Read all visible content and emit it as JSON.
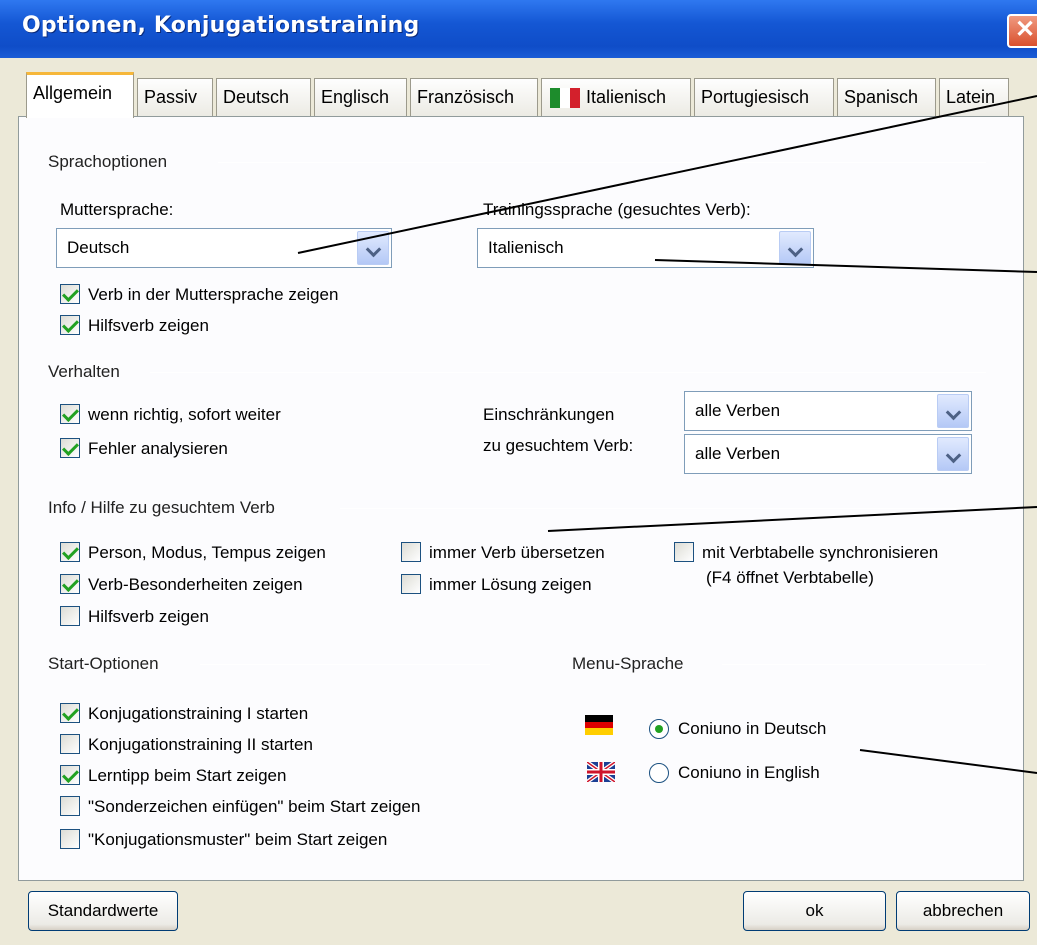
{
  "window": {
    "title": "Optionen, Konjugationstraining",
    "close_icon": "close-icon"
  },
  "tabs": [
    "Allgemein",
    "Passiv",
    "Deutsch",
    "Englisch",
    "Französisch",
    "Italienisch",
    "Portugiesisch",
    "Spanisch",
    "Latein"
  ],
  "sprachoptionen": {
    "title": "Sprachoptionen",
    "mutter_label": "Muttersprache:",
    "mutter_value": "Deutsch",
    "training_label": "Trainingssprache (gesuchtes Verb):",
    "training_value": "Italienisch",
    "cb_verb_mutter": "Verb in der Muttersprache zeigen",
    "cb_hilfsverb": "Hilfsverb zeigen"
  },
  "verhalten": {
    "title": "Verhalten",
    "cb_richtig": "wenn richtig, sofort weiter",
    "cb_fehler": "Fehler analysieren",
    "einschr_label1": "Einschränkungen",
    "einschr_label2": "zu gesuchtem Verb:",
    "select1": "alle Verben",
    "select2": "alle Verben"
  },
  "info": {
    "title": "Info / Hilfe zu gesuchtem Verb",
    "cb_person": "Person, Modus, Tempus zeigen",
    "cb_besonder": "Verb-Besonderheiten zeigen",
    "cb_hilfsverb": "Hilfsverb zeigen",
    "cb_uebersetzen": "immer Verb übersetzen",
    "cb_loesung": "immer Lösung zeigen",
    "cb_sync": "mit Verbtabelle synchronisieren",
    "sync_hint": "(F4 öffnet Verbtabelle)"
  },
  "start": {
    "title": "Start-Optionen",
    "cb1": "Konjugationstraining I starten",
    "cb2": "Konjugationstraining II starten",
    "cb3": "Lerntipp beim Start zeigen",
    "cb4": "\"Sonderzeichen einfügen\" beim Start zeigen",
    "cb5": "\"Konjugationsmuster\" beim Start zeigen"
  },
  "menu": {
    "title": "Menu-Sprache",
    "radio_de": "Coniuno in Deutsch",
    "radio_en": "Coniuno in English"
  },
  "buttons": {
    "standard": "Standardwerte",
    "ok": "ok",
    "cancel": "abbrechen"
  }
}
